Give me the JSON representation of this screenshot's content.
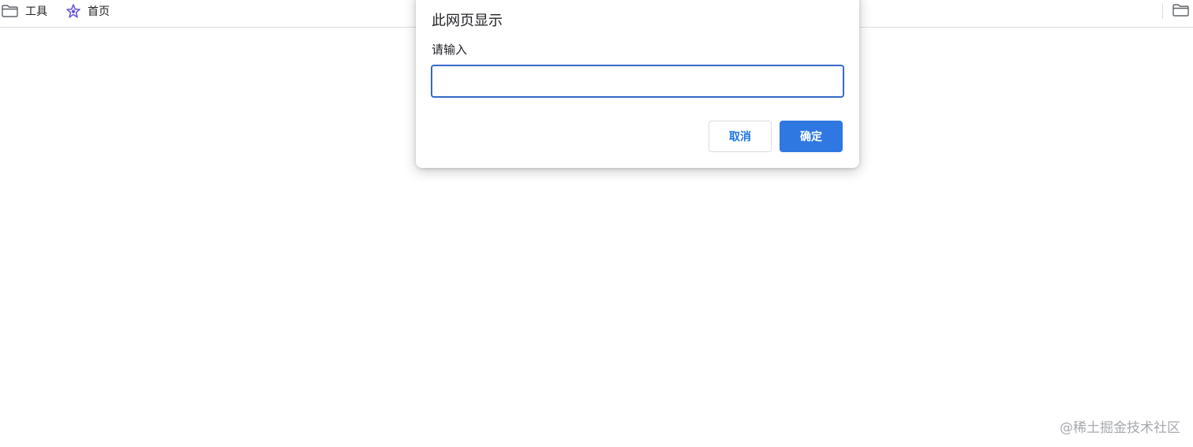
{
  "bookmarks_bar": {
    "items": [
      {
        "label": "工具",
        "icon": "folder-icon"
      },
      {
        "label": "首页",
        "icon": "star-favicon-icon"
      }
    ],
    "right_icon": "folder-icon"
  },
  "dialog": {
    "title": "此网页显示",
    "message": "请输入",
    "input_value": "",
    "input_placeholder": "",
    "cancel_label": "取消",
    "ok_label": "确定"
  },
  "watermark": "@稀土掘金技术社区",
  "colors": {
    "accent": "#2f78e2",
    "input_border": "#3469c8",
    "cancel_text": "#1a73e8",
    "divider": "#dadce0",
    "favicon_purple": "#6b55d6"
  }
}
